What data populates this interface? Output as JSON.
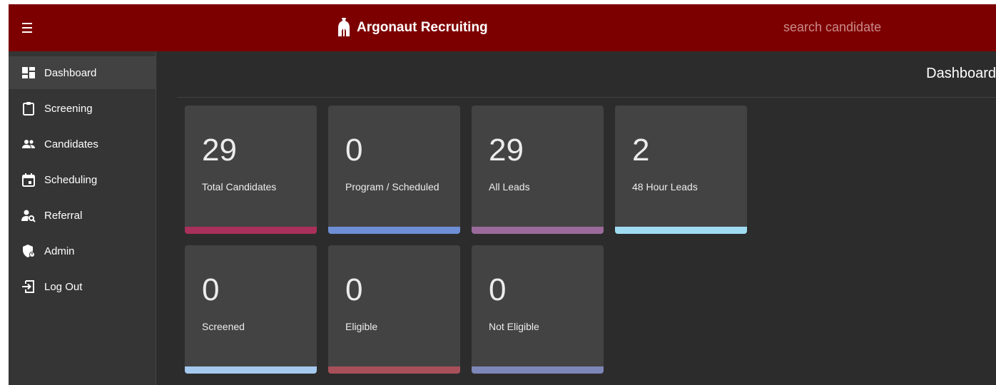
{
  "header": {
    "title": "Argonaut Recruiting",
    "search_placeholder": "search candidate",
    "menu_icon": "hamburger-menu-icon",
    "logo_icon": "spartan-helmet-icon"
  },
  "sidebar": {
    "items": [
      {
        "label": "Dashboard",
        "icon": "dashboard-icon",
        "active": true
      },
      {
        "label": "Screening",
        "icon": "clipboard-icon",
        "active": false
      },
      {
        "label": "Candidates",
        "icon": "people-icon",
        "active": false
      },
      {
        "label": "Scheduling",
        "icon": "calendar-icon",
        "active": false
      },
      {
        "label": "Referral",
        "icon": "person-search-icon",
        "active": false
      },
      {
        "label": "Admin",
        "icon": "admin-shield-icon",
        "active": false
      },
      {
        "label": "Log Out",
        "icon": "logout-icon",
        "active": false
      }
    ]
  },
  "main": {
    "page_title": "Dashboard",
    "cards": [
      {
        "value": "29",
        "label": "Total Candidates",
        "accent": "#a8305a"
      },
      {
        "value": "0",
        "label": "Program / Scheduled",
        "accent": "#6e8fd6"
      },
      {
        "value": "29",
        "label": "All Leads",
        "accent": "#9a6b9a"
      },
      {
        "value": "2",
        "label": "48 Hour Leads",
        "accent": "#9fdcf2"
      },
      {
        "value": "0",
        "label": "Screened",
        "accent": "#a4c8ee"
      },
      {
        "value": "0",
        "label": "Eligible",
        "accent": "#a8505a"
      },
      {
        "value": "0",
        "label": "Not Eligible",
        "accent": "#7d87b8"
      }
    ]
  },
  "colors": {
    "topbar": "#7d0000",
    "background": "#2c2c2c",
    "sidebar": "#353535",
    "card": "#434343"
  }
}
